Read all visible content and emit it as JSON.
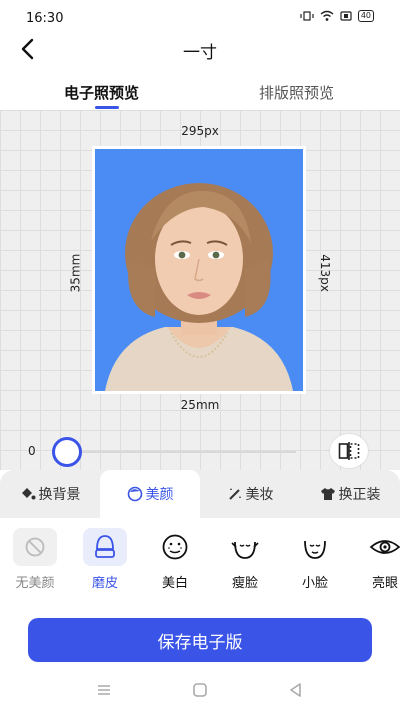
{
  "status_bar": {
    "time": "16:30",
    "battery": "40"
  },
  "header": {
    "title": "一寸"
  },
  "view_tabs": {
    "active": "电子照预览",
    "inactive": "排版照预览"
  },
  "preview": {
    "width_px_label": "295px",
    "height_px_label": "413px",
    "width_mm_label": "25mm",
    "height_mm_label": "35mm",
    "background_color": "#4a8cf3"
  },
  "slider": {
    "value": "0",
    "level": 0
  },
  "category_tabs": [
    {
      "label": "换背景",
      "icon": "paint-bucket-icon"
    },
    {
      "label": "美颜",
      "icon": "face-beauty-icon"
    },
    {
      "label": "美妆",
      "icon": "magic-wand-icon"
    },
    {
      "label": "换正装",
      "icon": "shirt-icon"
    }
  ],
  "active_category": "美颜",
  "effects": [
    {
      "label": "无美颜",
      "icon": "no-effect-icon"
    },
    {
      "label": "磨皮",
      "icon": "smooth-skin-icon"
    },
    {
      "label": "美白",
      "icon": "whiten-icon"
    },
    {
      "label": "瘦脸",
      "icon": "slim-face-icon"
    },
    {
      "label": "小脸",
      "icon": "small-face-icon"
    },
    {
      "label": "亮眼",
      "icon": "bright-eye-icon"
    }
  ],
  "selected_effect": "磨皮",
  "save_button": {
    "label": "保存电子版"
  },
  "accent_color": "#3a54e8"
}
